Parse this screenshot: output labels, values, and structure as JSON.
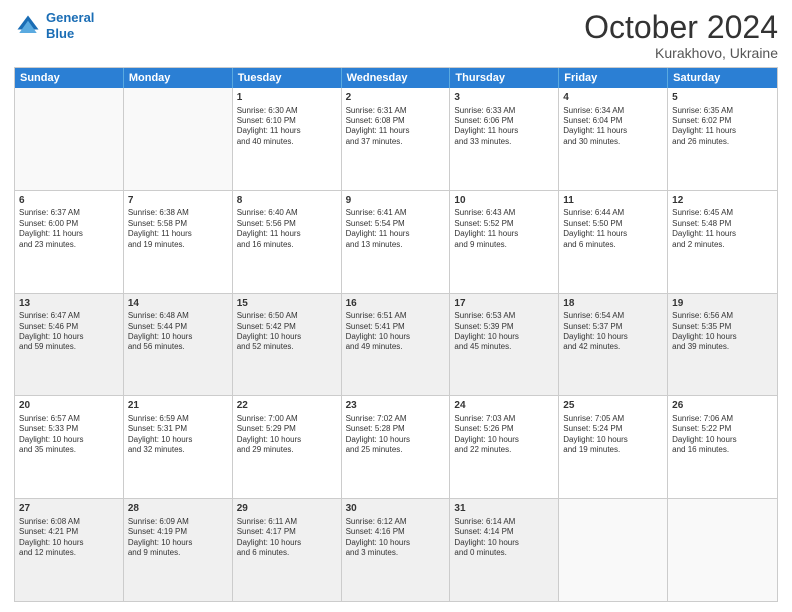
{
  "header": {
    "logo_line1": "General",
    "logo_line2": "Blue",
    "month": "October 2024",
    "location": "Kurakhovo, Ukraine"
  },
  "days_of_week": [
    "Sunday",
    "Monday",
    "Tuesday",
    "Wednesday",
    "Thursday",
    "Friday",
    "Saturday"
  ],
  "rows": [
    [
      {
        "day": "",
        "detail": "",
        "empty": true
      },
      {
        "day": "",
        "detail": "",
        "empty": true
      },
      {
        "day": "1",
        "detail": "Sunrise: 6:30 AM\nSunset: 6:10 PM\nDaylight: 11 hours\nand 40 minutes."
      },
      {
        "day": "2",
        "detail": "Sunrise: 6:31 AM\nSunset: 6:08 PM\nDaylight: 11 hours\nand 37 minutes."
      },
      {
        "day": "3",
        "detail": "Sunrise: 6:33 AM\nSunset: 6:06 PM\nDaylight: 11 hours\nand 33 minutes."
      },
      {
        "day": "4",
        "detail": "Sunrise: 6:34 AM\nSunset: 6:04 PM\nDaylight: 11 hours\nand 30 minutes."
      },
      {
        "day": "5",
        "detail": "Sunrise: 6:35 AM\nSunset: 6:02 PM\nDaylight: 11 hours\nand 26 minutes."
      }
    ],
    [
      {
        "day": "6",
        "detail": "Sunrise: 6:37 AM\nSunset: 6:00 PM\nDaylight: 11 hours\nand 23 minutes."
      },
      {
        "day": "7",
        "detail": "Sunrise: 6:38 AM\nSunset: 5:58 PM\nDaylight: 11 hours\nand 19 minutes."
      },
      {
        "day": "8",
        "detail": "Sunrise: 6:40 AM\nSunset: 5:56 PM\nDaylight: 11 hours\nand 16 minutes."
      },
      {
        "day": "9",
        "detail": "Sunrise: 6:41 AM\nSunset: 5:54 PM\nDaylight: 11 hours\nand 13 minutes."
      },
      {
        "day": "10",
        "detail": "Sunrise: 6:43 AM\nSunset: 5:52 PM\nDaylight: 11 hours\nand 9 minutes."
      },
      {
        "day": "11",
        "detail": "Sunrise: 6:44 AM\nSunset: 5:50 PM\nDaylight: 11 hours\nand 6 minutes."
      },
      {
        "day": "12",
        "detail": "Sunrise: 6:45 AM\nSunset: 5:48 PM\nDaylight: 11 hours\nand 2 minutes."
      }
    ],
    [
      {
        "day": "13",
        "detail": "Sunrise: 6:47 AM\nSunset: 5:46 PM\nDaylight: 10 hours\nand 59 minutes.",
        "shaded": true
      },
      {
        "day": "14",
        "detail": "Sunrise: 6:48 AM\nSunset: 5:44 PM\nDaylight: 10 hours\nand 56 minutes.",
        "shaded": true
      },
      {
        "day": "15",
        "detail": "Sunrise: 6:50 AM\nSunset: 5:42 PM\nDaylight: 10 hours\nand 52 minutes.",
        "shaded": true
      },
      {
        "day": "16",
        "detail": "Sunrise: 6:51 AM\nSunset: 5:41 PM\nDaylight: 10 hours\nand 49 minutes.",
        "shaded": true
      },
      {
        "day": "17",
        "detail": "Sunrise: 6:53 AM\nSunset: 5:39 PM\nDaylight: 10 hours\nand 45 minutes.",
        "shaded": true
      },
      {
        "day": "18",
        "detail": "Sunrise: 6:54 AM\nSunset: 5:37 PM\nDaylight: 10 hours\nand 42 minutes.",
        "shaded": true
      },
      {
        "day": "19",
        "detail": "Sunrise: 6:56 AM\nSunset: 5:35 PM\nDaylight: 10 hours\nand 39 minutes.",
        "shaded": true
      }
    ],
    [
      {
        "day": "20",
        "detail": "Sunrise: 6:57 AM\nSunset: 5:33 PM\nDaylight: 10 hours\nand 35 minutes."
      },
      {
        "day": "21",
        "detail": "Sunrise: 6:59 AM\nSunset: 5:31 PM\nDaylight: 10 hours\nand 32 minutes."
      },
      {
        "day": "22",
        "detail": "Sunrise: 7:00 AM\nSunset: 5:29 PM\nDaylight: 10 hours\nand 29 minutes."
      },
      {
        "day": "23",
        "detail": "Sunrise: 7:02 AM\nSunset: 5:28 PM\nDaylight: 10 hours\nand 25 minutes."
      },
      {
        "day": "24",
        "detail": "Sunrise: 7:03 AM\nSunset: 5:26 PM\nDaylight: 10 hours\nand 22 minutes."
      },
      {
        "day": "25",
        "detail": "Sunrise: 7:05 AM\nSunset: 5:24 PM\nDaylight: 10 hours\nand 19 minutes."
      },
      {
        "day": "26",
        "detail": "Sunrise: 7:06 AM\nSunset: 5:22 PM\nDaylight: 10 hours\nand 16 minutes."
      }
    ],
    [
      {
        "day": "27",
        "detail": "Sunrise: 6:08 AM\nSunset: 4:21 PM\nDaylight: 10 hours\nand 12 minutes.",
        "shaded": true
      },
      {
        "day": "28",
        "detail": "Sunrise: 6:09 AM\nSunset: 4:19 PM\nDaylight: 10 hours\nand 9 minutes.",
        "shaded": true
      },
      {
        "day": "29",
        "detail": "Sunrise: 6:11 AM\nSunset: 4:17 PM\nDaylight: 10 hours\nand 6 minutes.",
        "shaded": true
      },
      {
        "day": "30",
        "detail": "Sunrise: 6:12 AM\nSunset: 4:16 PM\nDaylight: 10 hours\nand 3 minutes.",
        "shaded": true
      },
      {
        "day": "31",
        "detail": "Sunrise: 6:14 AM\nSunset: 4:14 PM\nDaylight: 10 hours\nand 0 minutes.",
        "shaded": true
      },
      {
        "day": "",
        "detail": "",
        "empty": true
      },
      {
        "day": "",
        "detail": "",
        "empty": true
      }
    ]
  ]
}
